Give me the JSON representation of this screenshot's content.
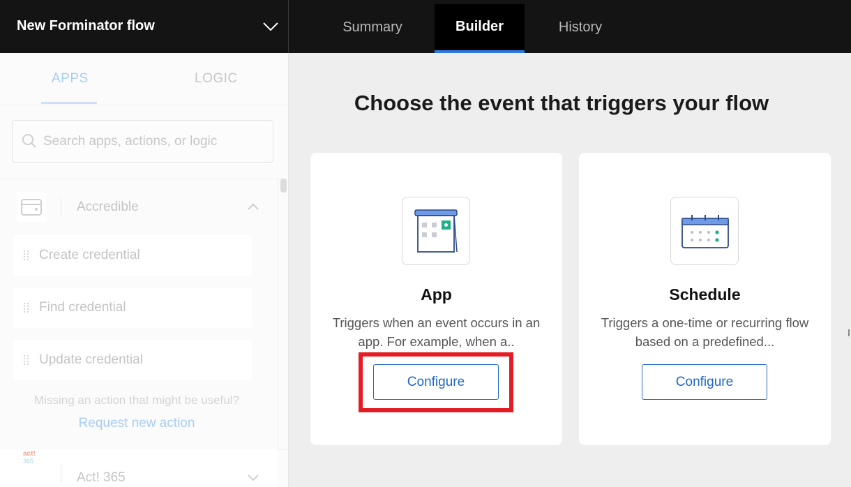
{
  "header": {
    "flow_name": "New Forminator flow",
    "tabs": [
      {
        "label": "Summary"
      },
      {
        "label": "Builder",
        "active": true
      },
      {
        "label": "History"
      }
    ]
  },
  "sidebar": {
    "tabs": [
      {
        "label": "APPS",
        "active": true
      },
      {
        "label": "LOGIC"
      }
    ],
    "search_placeholder": "Search apps, actions, or logic",
    "app": {
      "name": "Accredible",
      "expanded": true,
      "actions": [
        {
          "label": "Create credential"
        },
        {
          "label": "Find credential"
        },
        {
          "label": "Update credential"
        }
      ]
    },
    "missing_text": "Missing an action that might be useful?",
    "request_link": "Request new action",
    "next_app": {
      "name": "Act! 365",
      "logo_line1": "act!",
      "logo_line2": "365"
    }
  },
  "main": {
    "heading": "Choose the event that triggers your flow",
    "cards": [
      {
        "title": "App",
        "description": "Triggers when an event occurs in an app. For example, when a..",
        "button": "Configure",
        "highlighted": true
      },
      {
        "title": "Schedule",
        "description": "Triggers a one-time or recurring flow based on a predefined...",
        "button": "Configure"
      }
    ]
  },
  "colors": {
    "topbar": "#141414",
    "accent": "#2b78e4",
    "button_text": "#1f67c9",
    "highlight": "#e41c23",
    "teal": "#1fae8a"
  }
}
